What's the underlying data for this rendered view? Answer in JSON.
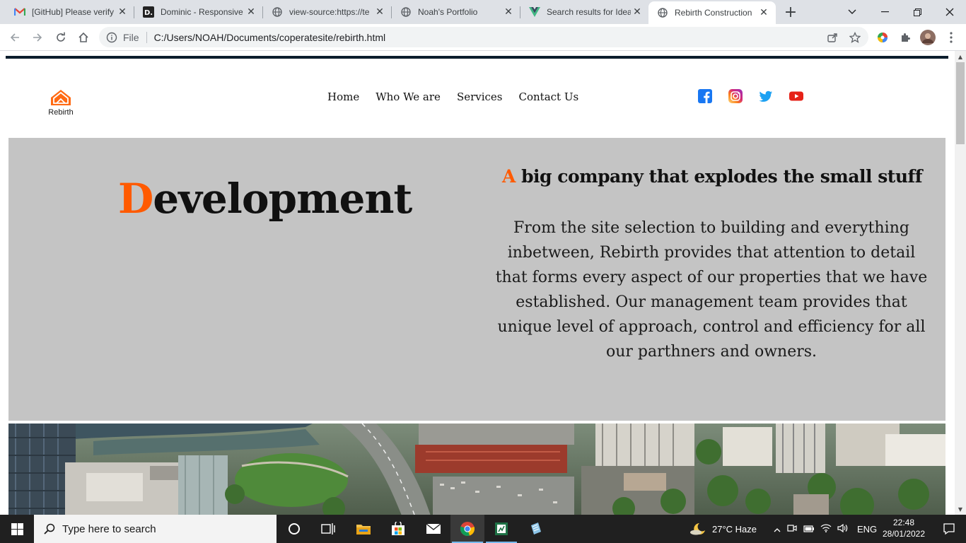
{
  "browser": {
    "tabs": [
      {
        "title": "[GitHub] Please verify",
        "icon": "gmail-icon"
      },
      {
        "title": "Dominic - Responsive",
        "icon": "dev-icon"
      },
      {
        "title": "view-source:https://te",
        "icon": "globe-icon"
      },
      {
        "title": "Noah's Portfolio",
        "icon": "globe-icon"
      },
      {
        "title": "Search results for Idea",
        "icon": "vue-icon"
      },
      {
        "title": "Rebirth Construction",
        "icon": "globe-icon",
        "active": true
      }
    ],
    "address": {
      "scheme_label": "File",
      "url": "C:/Users/NOAH/Documents/coperatesite/rebirth.html"
    }
  },
  "site": {
    "logo_text": "Rebirth",
    "nav": [
      "Home",
      "Who We are",
      "Services",
      "Contact Us"
    ],
    "social": [
      "facebook-icon",
      "instagram-icon",
      "twitter-icon",
      "youtube-icon"
    ],
    "hero": {
      "title_initial": "D",
      "title_rest": "evelopment",
      "subtitle_initial": "A",
      "subtitle_rest": " big company that explodes the small stuff",
      "body": "From the site selection to building and everything inbetween, Rebirth provides that attention to detail that forms every aspect of our properties that we have established. Our management team provides that unique level of approach, control and efficiency for all our parthners and owners."
    },
    "accent_color": "#ff5a00"
  },
  "taskbar": {
    "search_placeholder": "Type here to search",
    "weather": "27°C  Haze",
    "language": "ENG",
    "time": "22:48",
    "date": "28/01/2022"
  }
}
